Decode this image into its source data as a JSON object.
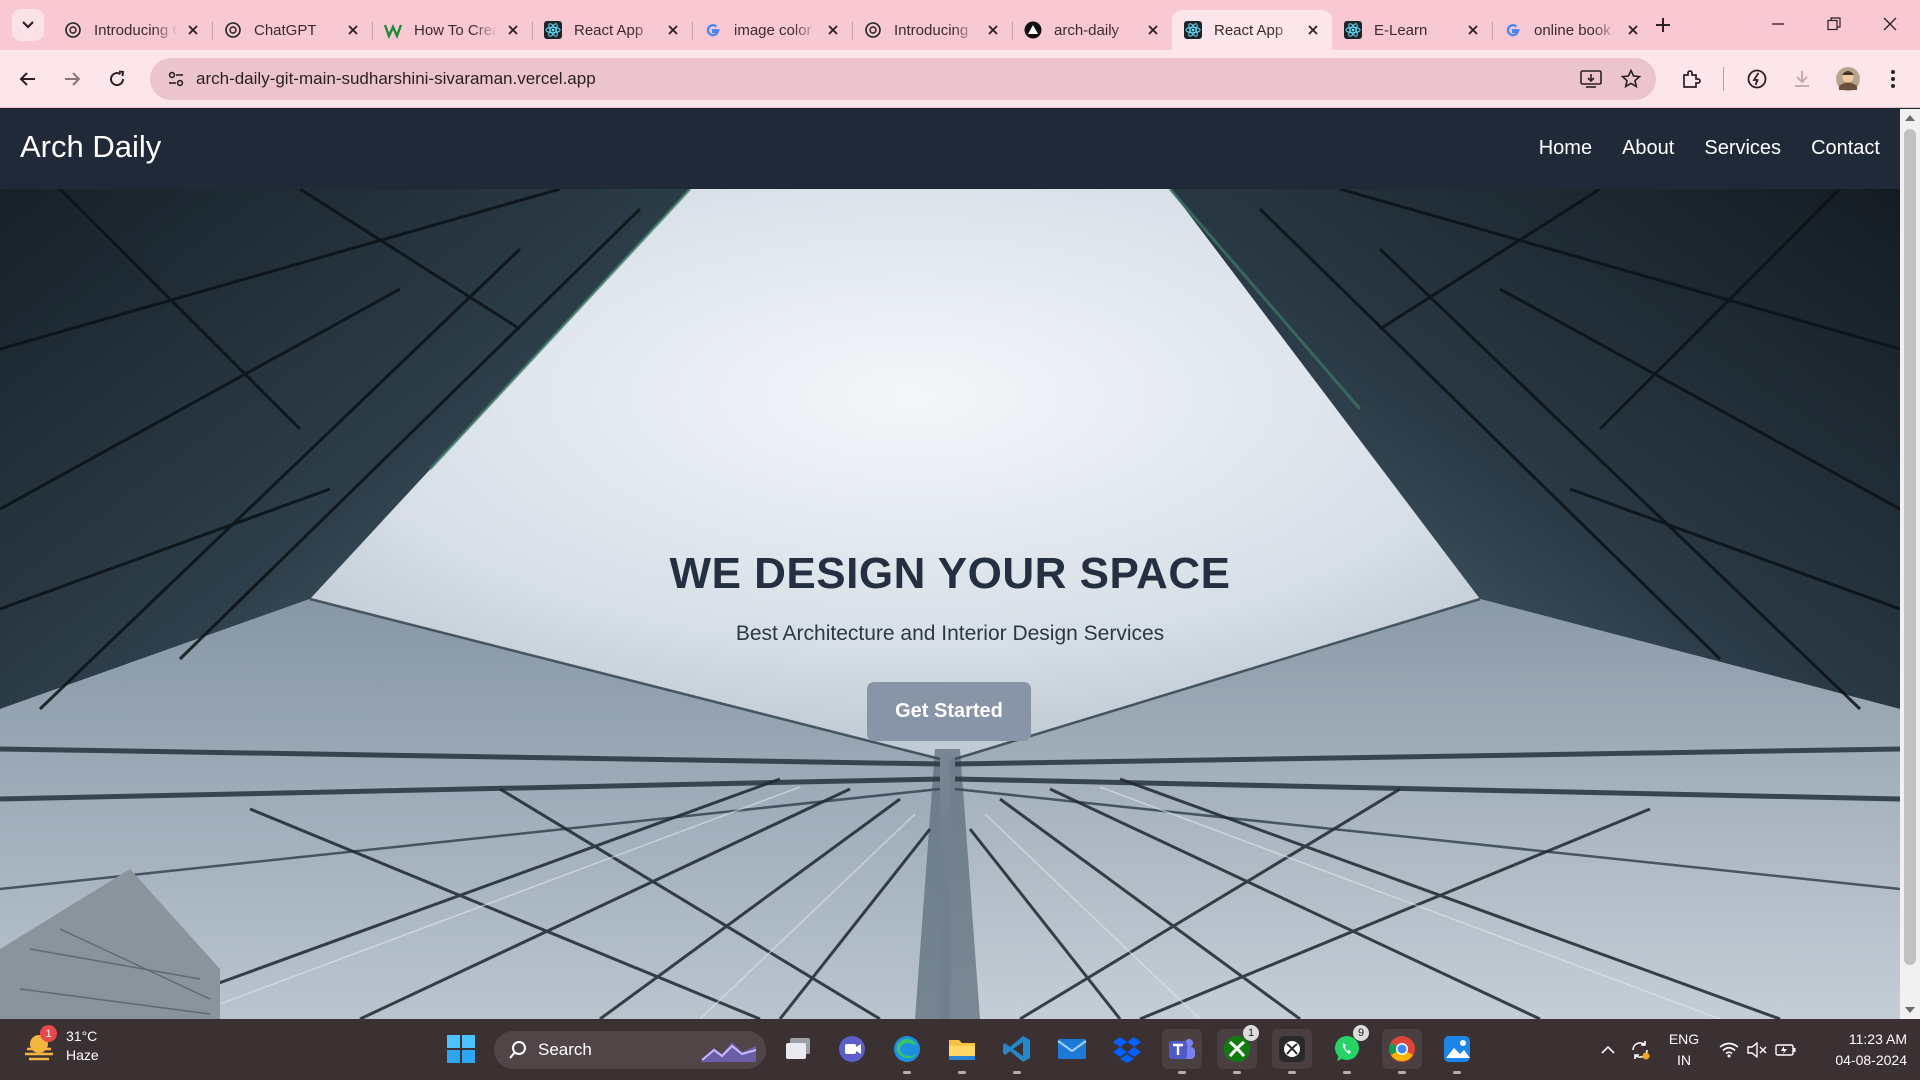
{
  "browser": {
    "tabs": [
      {
        "title": "Introducing ChatGPT",
        "favicon": "openai-icon"
      },
      {
        "title": "ChatGPT",
        "favicon": "openai-icon"
      },
      {
        "title": "How To Create",
        "favicon": "w-icon"
      },
      {
        "title": "React App",
        "favicon": "react-icon"
      },
      {
        "title": "image color",
        "favicon": "google-icon"
      },
      {
        "title": "Introducing",
        "favicon": "openai-icon"
      },
      {
        "title": "arch-daily",
        "favicon": "vercel-icon"
      },
      {
        "title": "React App",
        "favicon": "react-icon",
        "active": true
      },
      {
        "title": "E-Learn",
        "favicon": "react-icon"
      },
      {
        "title": "online book",
        "favicon": "google-icon"
      }
    ],
    "url": "arch-daily-git-main-sudharshini-sivaraman.vercel.app"
  },
  "site": {
    "brand": "Arch Daily",
    "nav": {
      "home": "Home",
      "about": "About",
      "services": "Services",
      "contact": "Contact"
    },
    "hero": {
      "title": "WE DESIGN YOUR SPACE",
      "subtitle": "Best Architecture and Interior Design Services",
      "cta": "Get Started"
    }
  },
  "taskbar": {
    "weather": {
      "temp": "31°C",
      "condition": "Haze",
      "badge": "1"
    },
    "search_label": "Search",
    "xbox_badge": "1",
    "whatsapp_badge": "9",
    "lang_1": "ENG",
    "lang_2": "IN",
    "time": "11:23 AM",
    "date": "04-08-2024"
  },
  "colors": {
    "tabbar": "#f9c9d3",
    "toolbar": "#fde6eb",
    "navbar": "#1f2937",
    "cta": "#8895a7",
    "taskbar": "#3b3032"
  }
}
